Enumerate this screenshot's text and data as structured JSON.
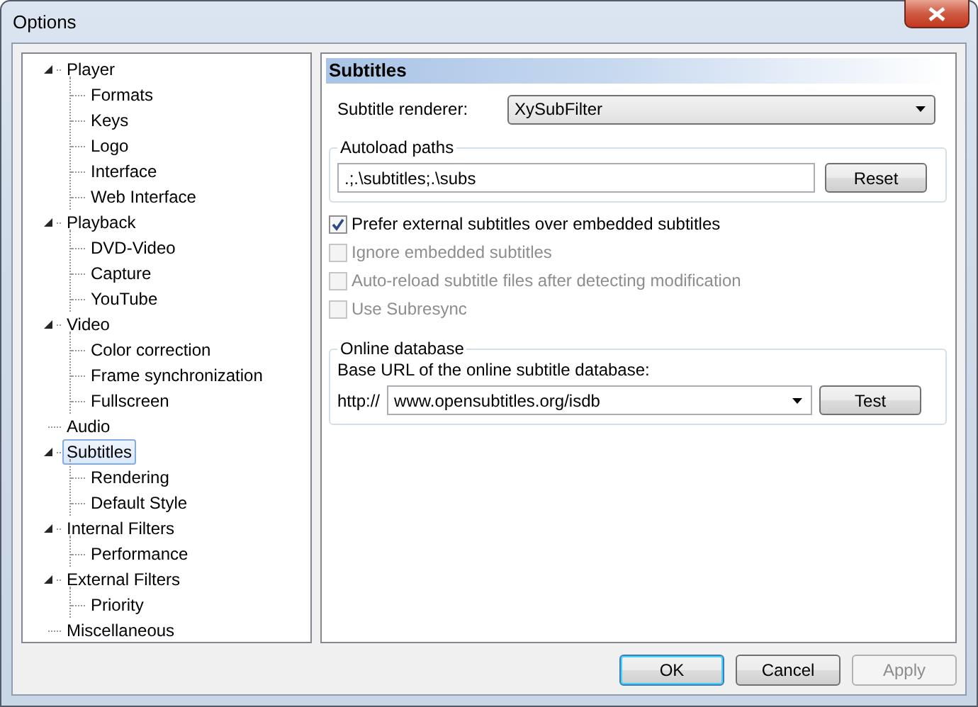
{
  "window": {
    "title": "Options"
  },
  "tree": [
    {
      "label": "Player",
      "expanded": true,
      "selected": false,
      "children": [
        {
          "label": "Formats",
          "selected": false
        },
        {
          "label": "Keys",
          "selected": false
        },
        {
          "label": "Logo",
          "selected": false
        },
        {
          "label": "Interface",
          "selected": false
        },
        {
          "label": "Web Interface",
          "selected": false
        }
      ]
    },
    {
      "label": "Playback",
      "expanded": true,
      "selected": false,
      "children": [
        {
          "label": "DVD-Video",
          "selected": false
        },
        {
          "label": "Capture",
          "selected": false
        },
        {
          "label": "YouTube",
          "selected": false
        }
      ]
    },
    {
      "label": "Video",
      "expanded": true,
      "selected": false,
      "children": [
        {
          "label": "Color correction",
          "selected": false
        },
        {
          "label": "Frame synchronization",
          "selected": false
        },
        {
          "label": "Fullscreen",
          "selected": false
        }
      ]
    },
    {
      "label": "Audio",
      "selected": false
    },
    {
      "label": "Subtitles",
      "expanded": true,
      "selected": true,
      "children": [
        {
          "label": "Rendering",
          "selected": false
        },
        {
          "label": "Default Style",
          "selected": false
        }
      ]
    },
    {
      "label": "Internal Filters",
      "expanded": true,
      "selected": false,
      "children": [
        {
          "label": "Performance",
          "selected": false
        }
      ]
    },
    {
      "label": "External Filters",
      "expanded": true,
      "selected": false,
      "children": [
        {
          "label": "Priority",
          "selected": false
        }
      ]
    },
    {
      "label": "Miscellaneous",
      "selected": false
    }
  ],
  "page": {
    "title": "Subtitles",
    "renderer": {
      "label": "Subtitle renderer:",
      "value": "XySubFilter"
    },
    "autoload": {
      "title": "Autoload paths",
      "value": ".;.\\subtitles;.\\subs",
      "button": "Reset"
    },
    "options": [
      {
        "label": "Prefer external subtitles over embedded subtitles",
        "checked": true,
        "disabled": false
      },
      {
        "label": "Ignore embedded subtitles",
        "checked": false,
        "disabled": true
      },
      {
        "label": "Auto-reload subtitle files after detecting modification",
        "checked": false,
        "disabled": true
      },
      {
        "label": "Use Subresync",
        "checked": false,
        "disabled": true
      }
    ],
    "online": {
      "title": "Online database",
      "label": "Base URL of the online subtitle database:",
      "prefix": "http://",
      "value": "www.opensubtitles.org/isdb",
      "button": "Test"
    }
  },
  "buttons": [
    {
      "label": "OK",
      "default": true,
      "disabled": false
    },
    {
      "label": "Cancel",
      "default": false,
      "disabled": false
    },
    {
      "label": "Apply",
      "default": false,
      "disabled": true
    }
  ]
}
